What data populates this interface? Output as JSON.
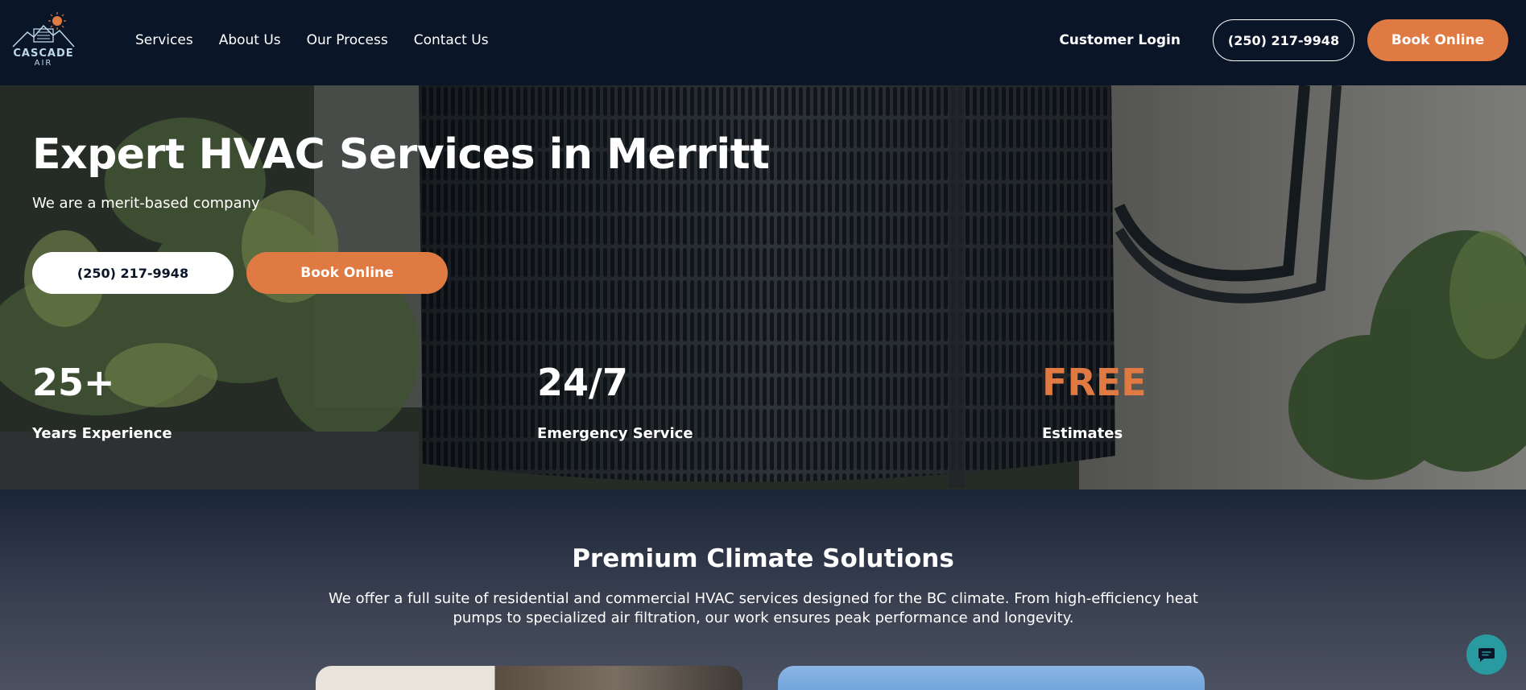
{
  "brand": {
    "name": "CASCADE",
    "sub": "AIR"
  },
  "nav": {
    "links": [
      "Services",
      "About Us",
      "Our Process",
      "Contact Us"
    ],
    "login": "Customer Login",
    "phone": "(250) 217-9948",
    "book": "Book Online"
  },
  "hero": {
    "title": "Expert HVAC Services in Merritt",
    "subtitle": "We are a merit-based company",
    "phone_button": "(250) 217-9948",
    "book_button": "Book Online",
    "stats": [
      {
        "value": "25+",
        "label": "Years Experience"
      },
      {
        "value": "24/7",
        "label": "Emergency Service"
      },
      {
        "value": "FREE",
        "label": "Estimates"
      }
    ]
  },
  "section": {
    "title": "Premium Climate Solutions",
    "description": "We offer a full suite of residential and commercial HVAC services designed for the BC climate. From high-efficiency heat pumps to specialized air filtration, our work ensures peak performance and longevity."
  },
  "colors": {
    "accent": "#e07a43",
    "nav_bg": "#0a1628",
    "chat": "#2a9aa1"
  },
  "icons": {
    "chat": "chat-bubble-icon",
    "logo": "mountain-sun-icon"
  }
}
